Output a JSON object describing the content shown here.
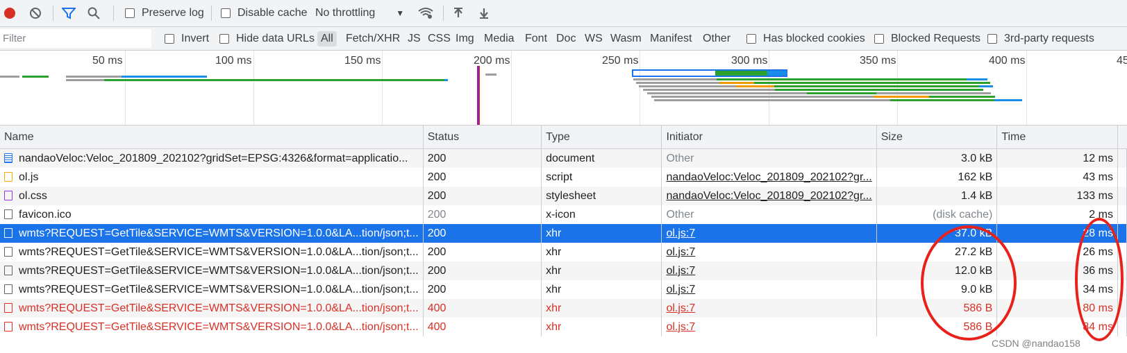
{
  "toolbar": {
    "preserve_log": "Preserve log",
    "disable_cache": "Disable cache",
    "throttling": "No throttling"
  },
  "filterbar": {
    "filter_placeholder": "Filter",
    "invert": "Invert",
    "hide_data_urls": "Hide data URLs",
    "types": [
      "All",
      "Fetch/XHR",
      "JS",
      "CSS",
      "Img",
      "Media",
      "Font",
      "Doc",
      "WS",
      "Wasm",
      "Manifest",
      "Other"
    ],
    "has_blocked_cookies": "Has blocked cookies",
    "blocked_requests": "Blocked Requests",
    "third_party": "3rd-party requests"
  },
  "timeline": {
    "ticks": [
      "50 ms",
      "100 ms",
      "150 ms",
      "200 ms",
      "250 ms",
      "300 ms",
      "350 ms",
      "400 ms",
      "45"
    ]
  },
  "table": {
    "headers": [
      "Name",
      "Status",
      "Type",
      "Initiator",
      "Size",
      "Time"
    ],
    "rows": [
      {
        "name": "nandaoVeloc:Veloc_201809_202102?gridSet=EPSG:4326&format=applicatio...",
        "status": "200",
        "type": "document",
        "initiator": "Other",
        "size": "3.0 kB",
        "time": "12 ms"
      },
      {
        "name": "ol.js",
        "status": "200",
        "type": "script",
        "initiator": "nandaoVeloc:Veloc_201809_202102?gr...",
        "size": "162 kB",
        "time": "43 ms"
      },
      {
        "name": "ol.css",
        "status": "200",
        "type": "stylesheet",
        "initiator": "nandaoVeloc:Veloc_201809_202102?gr...",
        "size": "1.4 kB",
        "time": "133 ms"
      },
      {
        "name": "favicon.ico",
        "status": "200",
        "type": "x-icon",
        "initiator": "Other",
        "size": "(disk cache)",
        "time": "2 ms"
      },
      {
        "name": "wmts?REQUEST=GetTile&SERVICE=WMTS&VERSION=1.0.0&LA...tion/json;t...",
        "status": "200",
        "type": "xhr",
        "initiator": "ol.js:7",
        "size": "37.0 kB",
        "time": "28 ms"
      },
      {
        "name": "wmts?REQUEST=GetTile&SERVICE=WMTS&VERSION=1.0.0&LA...tion/json;t...",
        "status": "200",
        "type": "xhr",
        "initiator": "ol.js:7",
        "size": "27.2 kB",
        "time": "26 ms"
      },
      {
        "name": "wmts?REQUEST=GetTile&SERVICE=WMTS&VERSION=1.0.0&LA...tion/json;t...",
        "status": "200",
        "type": "xhr",
        "initiator": "ol.js:7",
        "size": "12.0 kB",
        "time": "36 ms"
      },
      {
        "name": "wmts?REQUEST=GetTile&SERVICE=WMTS&VERSION=1.0.0&LA...tion/json;t...",
        "status": "200",
        "type": "xhr",
        "initiator": "ol.js:7",
        "size": "9.0 kB",
        "time": "34 ms"
      },
      {
        "name": "wmts?REQUEST=GetTile&SERVICE=WMTS&VERSION=1.0.0&LA...tion/json;t...",
        "status": "400",
        "type": "xhr",
        "initiator": "ol.js:7",
        "size": "586 B",
        "time": "80 ms"
      },
      {
        "name": "wmts?REQUEST=GetTile&SERVICE=WMTS&VERSION=1.0.0&LA...tion/json;t...",
        "status": "400",
        "type": "xhr",
        "initiator": "ol.js:7",
        "size": "586 B",
        "time": "84 ms"
      }
    ]
  },
  "watermark": "CSDN @nandao158",
  "colors": {
    "selected_row": "#1a73e8",
    "error": "#d93025",
    "annotation": "#e8211a",
    "record": "#d93025"
  }
}
